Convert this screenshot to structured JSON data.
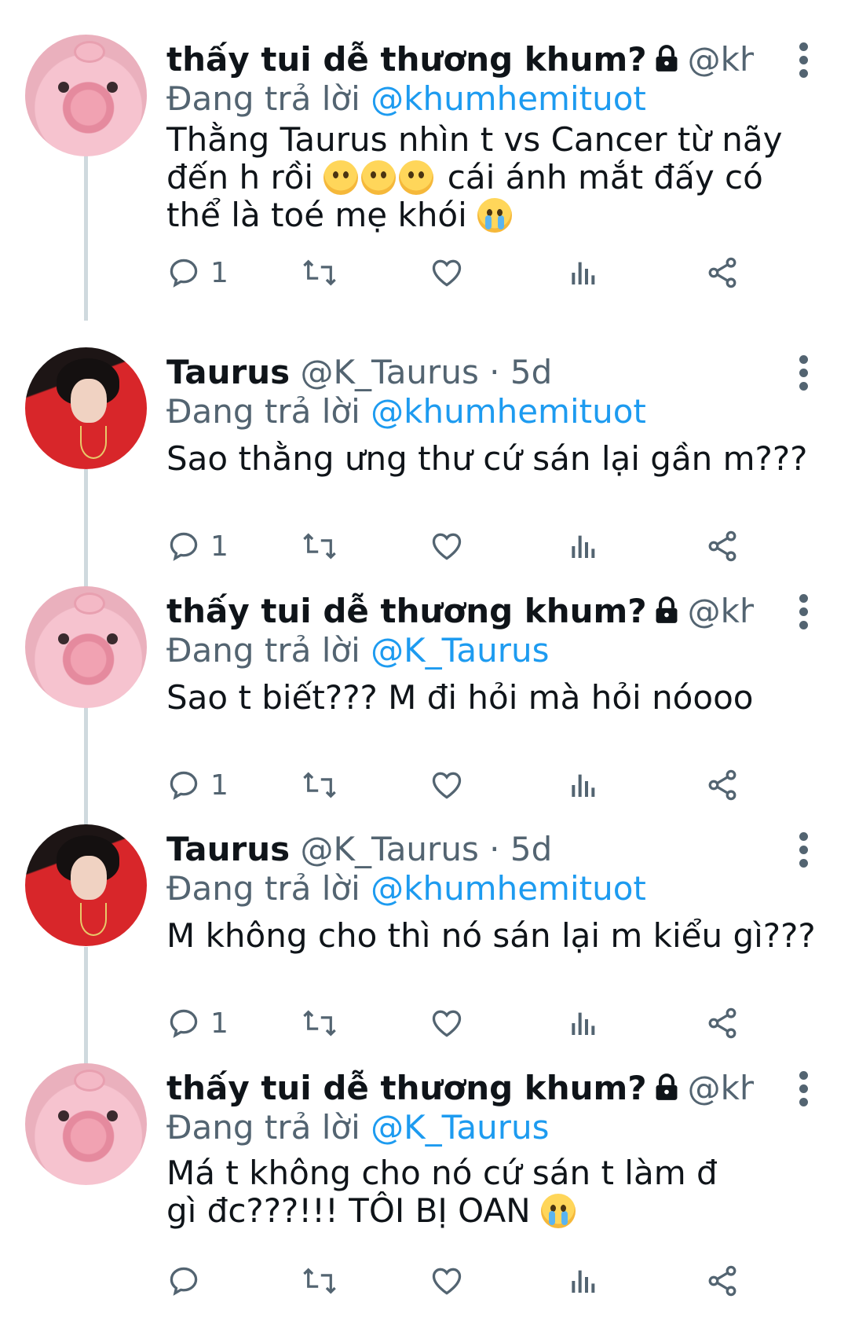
{
  "tweets": [
    {
      "name": "thấy tui dễ thương khum?",
      "locked": true,
      "handle": "@khu···",
      "replying_prefix": "Đang trả lời ",
      "replying_to": "@khumhemituot",
      "text_parts": [
        "Thằng Taurus nhìn t vs Cancer từ nãy đến h rồi ",
        " cái ánh mắt đấy có thể là toé mẹ khói "
      ],
      "reply_count": "1",
      "avatar": "pink"
    },
    {
      "name": "Taurus",
      "locked": false,
      "handle": "@K_Taurus · 5d",
      "replying_prefix": "Đang trả lời ",
      "replying_to": "@khumhemituot",
      "text": "Sao thằng ưng thư cứ sán lại gần m???",
      "reply_count": "1",
      "avatar": "red"
    },
    {
      "name": "thấy tui dễ thương khum?",
      "locked": true,
      "handle": "@khu···",
      "replying_prefix": "Đang trả lời ",
      "replying_to": "@K_Taurus",
      "text": "Sao t biết??? M đi hỏi mà hỏi nóooo",
      "reply_count": "1",
      "avatar": "pink"
    },
    {
      "name": "Taurus",
      "locked": false,
      "handle": "@K_Taurus · 5d",
      "replying_prefix": "Đang trả lời ",
      "replying_to": "@khumhemituot",
      "text": "M không cho thì nó sán lại m kiểu gì???",
      "reply_count": "1",
      "avatar": "red"
    },
    {
      "name": "thấy tui dễ thương khum?",
      "locked": true,
      "handle": "@khu···",
      "replying_prefix": "Đang trả lời ",
      "replying_to": "@K_Taurus",
      "text_parts": [
        "Má t không cho nó cứ sán t làm đ gì đc???!!! TÔI BỊ OAN "
      ],
      "reply_count": "",
      "avatar": "pink"
    }
  ],
  "icons": {
    "reply": "reply-icon",
    "retweet": "retweet-icon",
    "like": "heart-icon",
    "views": "views-icon",
    "share": "share-icon",
    "more": "more-options-icon",
    "lock": "lock-icon"
  },
  "colors": {
    "text": "#0f1419",
    "secondary": "#536471",
    "link": "#1d9bf0",
    "thread_line": "#cfd9de"
  }
}
